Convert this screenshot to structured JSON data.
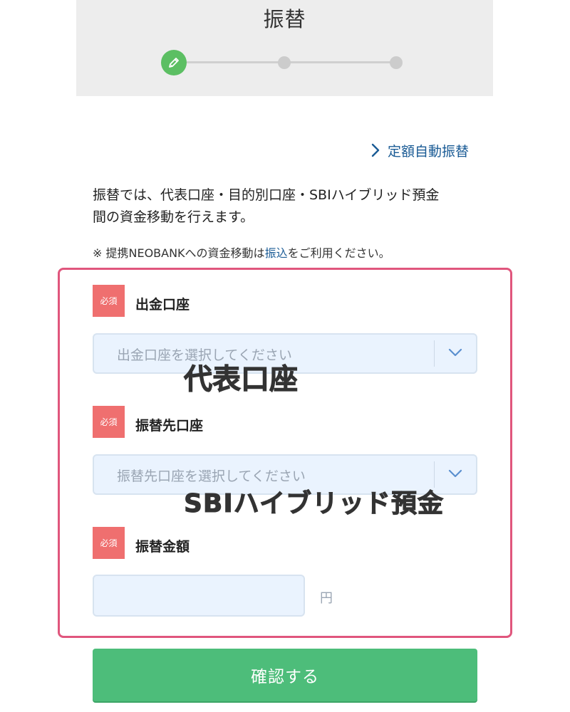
{
  "header": {
    "title": "振替"
  },
  "stepper": {
    "total_steps": 3,
    "current_step": 1,
    "colors": {
      "active": "#5cbf63",
      "inactive": "#cccccc"
    }
  },
  "auto_transfer_link": {
    "label": "定額自動振替"
  },
  "description": {
    "line1": "振替では、代表口座・目的別口座・SBIハイブリッド預金",
    "line2": "間の資金移動を行えます。"
  },
  "note": {
    "prefix": "※ 提携NEOBANKへの資金移動は",
    "link": "振込",
    "suffix": "をご利用ください。"
  },
  "form": {
    "required_badge": "必須",
    "source_account": {
      "label": "出金口座",
      "placeholder": "出金口座を選択してください",
      "overlay": "代表口座"
    },
    "destination_account": {
      "label": "振替先口座",
      "placeholder": "振替先口座を選択してください",
      "overlay": "SBIハイブリッド預金"
    },
    "amount": {
      "label": "振替金額",
      "value": "",
      "unit": "円"
    }
  },
  "confirm_button": {
    "label": "確認する",
    "color": "#4dbd7a"
  },
  "colors": {
    "link": "#1a5b95",
    "required_badge": "#ef6f6f",
    "highlight_border": "#e0567d",
    "input_bg": "#eaf3fe"
  }
}
